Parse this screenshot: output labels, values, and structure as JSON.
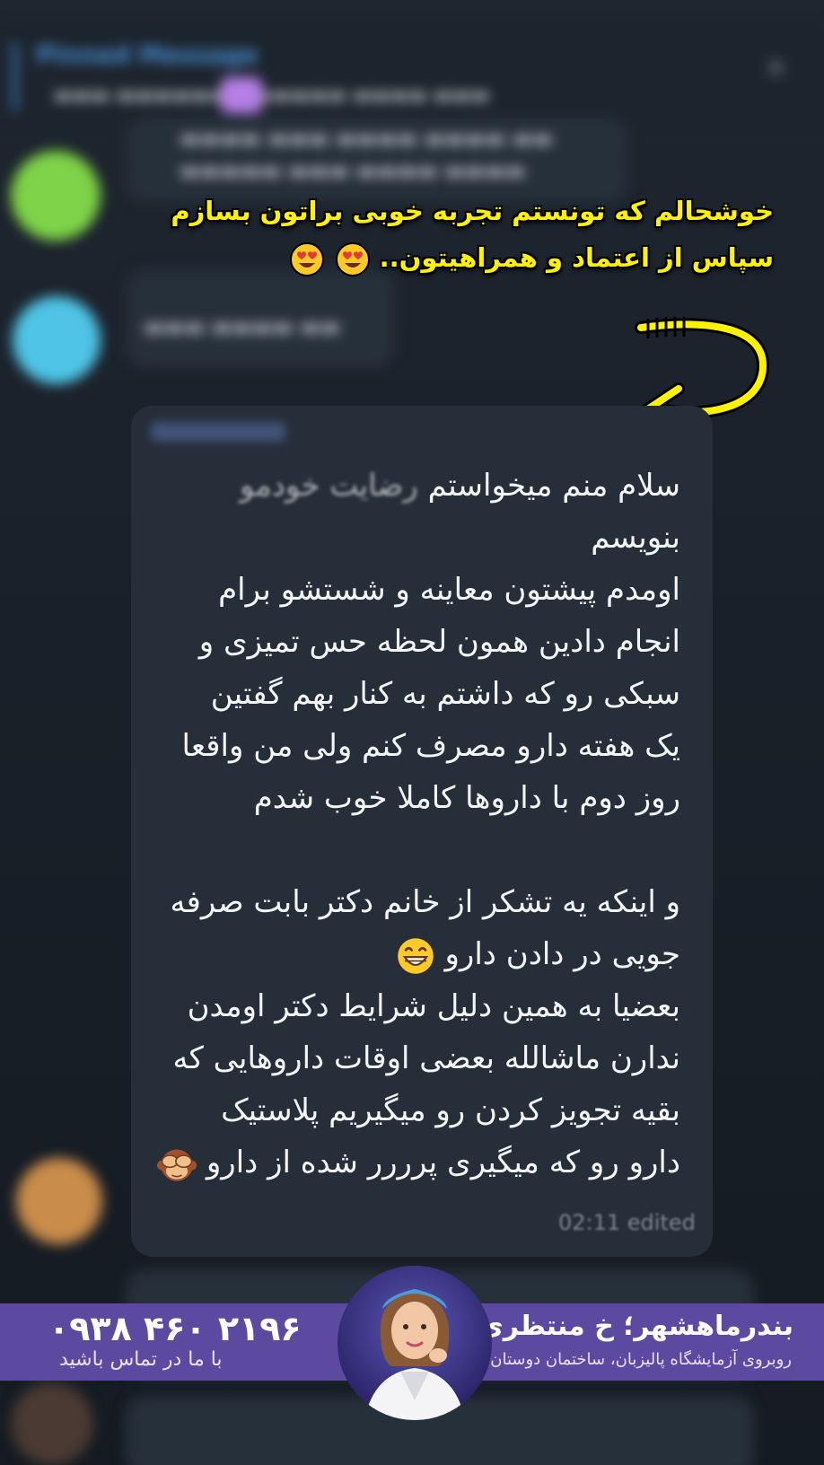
{
  "pinned": {
    "title": "Pinned Message",
    "close_glyph": "×"
  },
  "caption": {
    "line1": "خوشحالم که تونستم تجربه خوبی براتون بسازم",
    "line2": "سپاس از اعتماد و همراهیتون..",
    "emoji": "heart-eyes-icon"
  },
  "message": {
    "lines": [
      {
        "text": "سلام منم میخواستم",
        "faded": "رضایت خودمو"
      },
      {
        "text": "بنویسم",
        "faded": ""
      },
      {
        "text": "اومدم پیشتون معاینه و شستشو برام",
        "faded": ""
      },
      {
        "text": "انجام دادین همون لحظه حس تمیزی و",
        "faded": ""
      },
      {
        "text": "سبکی رو که داشتم به کنار بهم گفتین",
        "faded": ""
      },
      {
        "text": "یک هفته دارو مصرف کنم ولی من واقعا",
        "faded": ""
      },
      {
        "text": "روز دوم با داروها کاملا خوب شدم",
        "faded": ""
      },
      {
        "text": "",
        "faded": ""
      },
      {
        "text": "و اینکه یه تشکر از خانم دکتر بابت صرفه",
        "faded": ""
      },
      {
        "text": "جویی در دادن دارو",
        "faded": ""
      },
      {
        "text": "بعضیا به همین دلیل شرایط دکتر اومدن",
        "faded": ""
      },
      {
        "text": "ندارن ماشالله بعضی اوقات داروهایی که",
        "faded": ""
      },
      {
        "text": "بقیه تجویز کردن  رو میگیریم  پلاستیک",
        "faded": ""
      },
      {
        "text": "دارو رو که میگیری پرررر شده از دارو",
        "faded": ""
      }
    ],
    "time": "02:11 edited"
  },
  "banner": {
    "phone": "۰۹۳۸ ۴۶۰ ۲۱۹۶",
    "phone_sub": "با ما در تماس باشید",
    "address_title": "بندرماهشهر؛ خ منتظری",
    "address_sub": "روبروی آزمایشگاه پالیزبان، ساختمان دوستان"
  },
  "colors": {
    "caption": "#fff200",
    "banner": "#5b4aa0",
    "bubble": "#252e39",
    "accent": "#4a8fd6"
  }
}
